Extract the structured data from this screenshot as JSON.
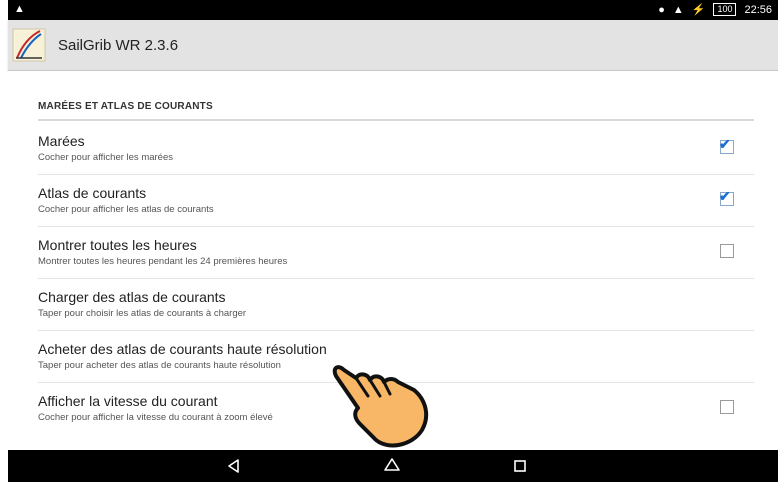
{
  "status": {
    "battery": "100",
    "time": "22:56"
  },
  "app": {
    "title": "SailGrib WR 2.3.6"
  },
  "section": {
    "title": "MARÉES ET ATLAS DE COURANTS"
  },
  "prefs": [
    {
      "title": "Marées",
      "summary": "Cocher pour afficher les marées",
      "checkbox": true,
      "checked": true
    },
    {
      "title": "Atlas de courants",
      "summary": "Cocher pour afficher les atlas de courants",
      "checkbox": true,
      "checked": true
    },
    {
      "title": "Montrer toutes les heures",
      "summary": "Montrer toutes les heures pendant les 24 premières heures",
      "checkbox": true,
      "checked": false
    },
    {
      "title": "Charger des atlas de courants",
      "summary": "Taper pour choisir les atlas de courants à charger",
      "checkbox": false
    },
    {
      "title": "Acheter des atlas de courants haute résolution",
      "summary": "Taper pour acheter des atlas de courants haute résolution",
      "checkbox": false
    },
    {
      "title": "Afficher la vitesse du courant",
      "summary": "Cocher pour afficher la vitesse du courant à zoom élevé",
      "checkbox": true,
      "checked": false
    }
  ],
  "nav": {
    "back": "back-icon",
    "home": "home-icon",
    "recents": "recents-icon"
  }
}
